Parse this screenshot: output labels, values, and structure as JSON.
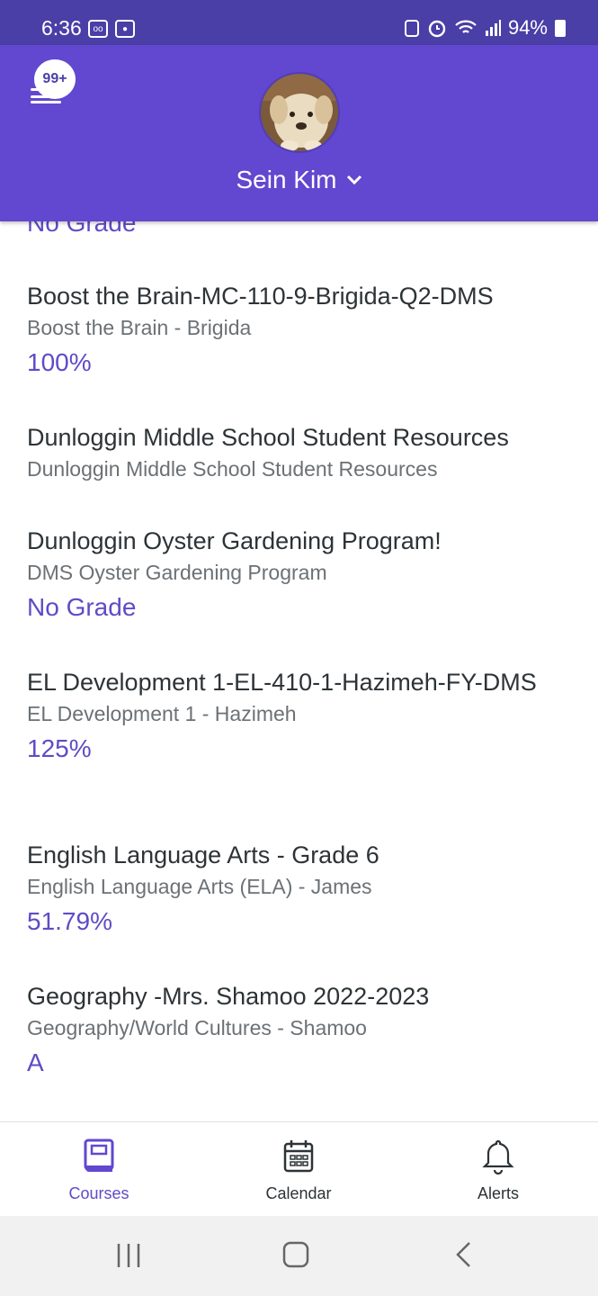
{
  "status_bar": {
    "time": "6:36",
    "battery": "94%"
  },
  "header": {
    "badge": "99+",
    "user_name": "Sein Kim",
    "accent": "#6247d0"
  },
  "partial_grade": "No Grade",
  "courses": [
    {
      "title": "Boost the Brain-MC-110-9-Brigida-Q2-DMS",
      "subtitle": "Boost the Brain - Brigida",
      "grade": "100%"
    },
    {
      "title": "Dunloggin Middle School Student Resources",
      "subtitle": "Dunloggin Middle School Student Resources",
      "grade": ""
    },
    {
      "title": "Dunloggin Oyster Gardening Program!",
      "subtitle": "DMS Oyster Gardening Program",
      "grade": "No Grade"
    },
    {
      "title": "EL Development 1-EL-410-1-Hazimeh-FY-DMS",
      "subtitle": "EL Development 1 - Hazimeh",
      "grade": "125%"
    },
    {
      "title": "English Language Arts - Grade 6",
      "subtitle": "English Language Arts (ELA) - James",
      "grade": "51.79%"
    },
    {
      "title": "Geography -Mrs. Shamoo 2022-2023",
      "subtitle": "Geography/World Cultures - Shamoo",
      "grade": "A"
    }
  ],
  "bottom_nav": {
    "courses": "Courses",
    "calendar": "Calendar",
    "alerts": "Alerts"
  }
}
